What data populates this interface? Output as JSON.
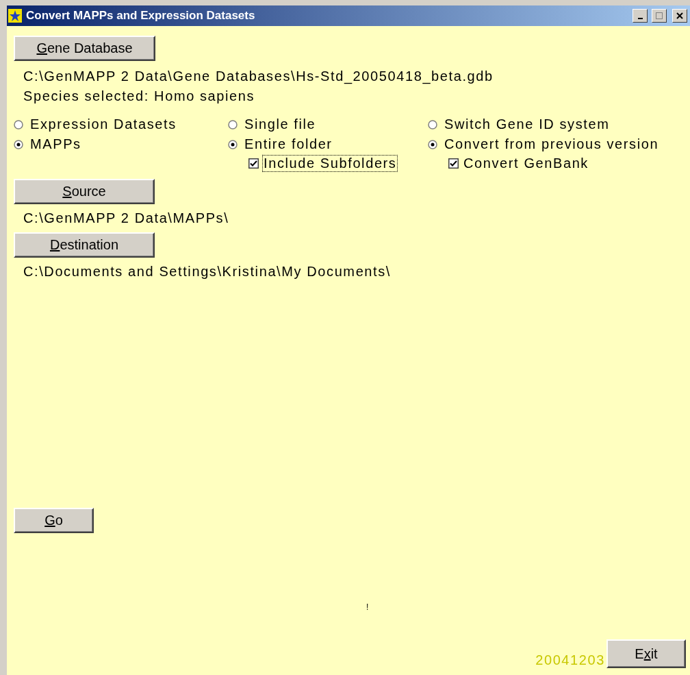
{
  "window": {
    "title": "Convert MAPPs and Expression Datasets"
  },
  "gene_database": {
    "button": {
      "key": "G",
      "after": "ene Database"
    },
    "path": "C:\\GenMAPP 2 Data\\Gene Databases\\Hs-Std_20050418_beta.gdb",
    "species": "Species selected: Homo sapiens"
  },
  "option_groups": [
    {
      "options": [
        {
          "label": "Expression Datasets",
          "selected": false
        },
        {
          "label": "MAPPs",
          "selected": true
        }
      ]
    },
    {
      "options": [
        {
          "label": "Single file",
          "selected": false
        },
        {
          "label": "Entire folder",
          "selected": true
        }
      ],
      "checkbox": {
        "label": "Include Subfolders",
        "checked": true,
        "focused": true
      }
    },
    {
      "options": [
        {
          "label": "Switch Gene ID system",
          "selected": false
        },
        {
          "label": "Convert from previous version",
          "selected": true
        }
      ],
      "checkbox": {
        "label": "Convert GenBank",
        "checked": true,
        "focused": false
      }
    }
  ],
  "source": {
    "button": {
      "key": "S",
      "after": "ource"
    },
    "path": "C:\\GenMAPP 2 Data\\MAPPs\\"
  },
  "destination": {
    "button": {
      "key": "D",
      "after": "estination"
    },
    "path": "C:\\Documents and Settings\\Kristina\\My Documents\\"
  },
  "go_button": {
    "key": "G",
    "after": "o"
  },
  "status_mark": "!",
  "version": "20041203",
  "exit_button": {
    "before": "E",
    "key": "x",
    "after": "it"
  }
}
